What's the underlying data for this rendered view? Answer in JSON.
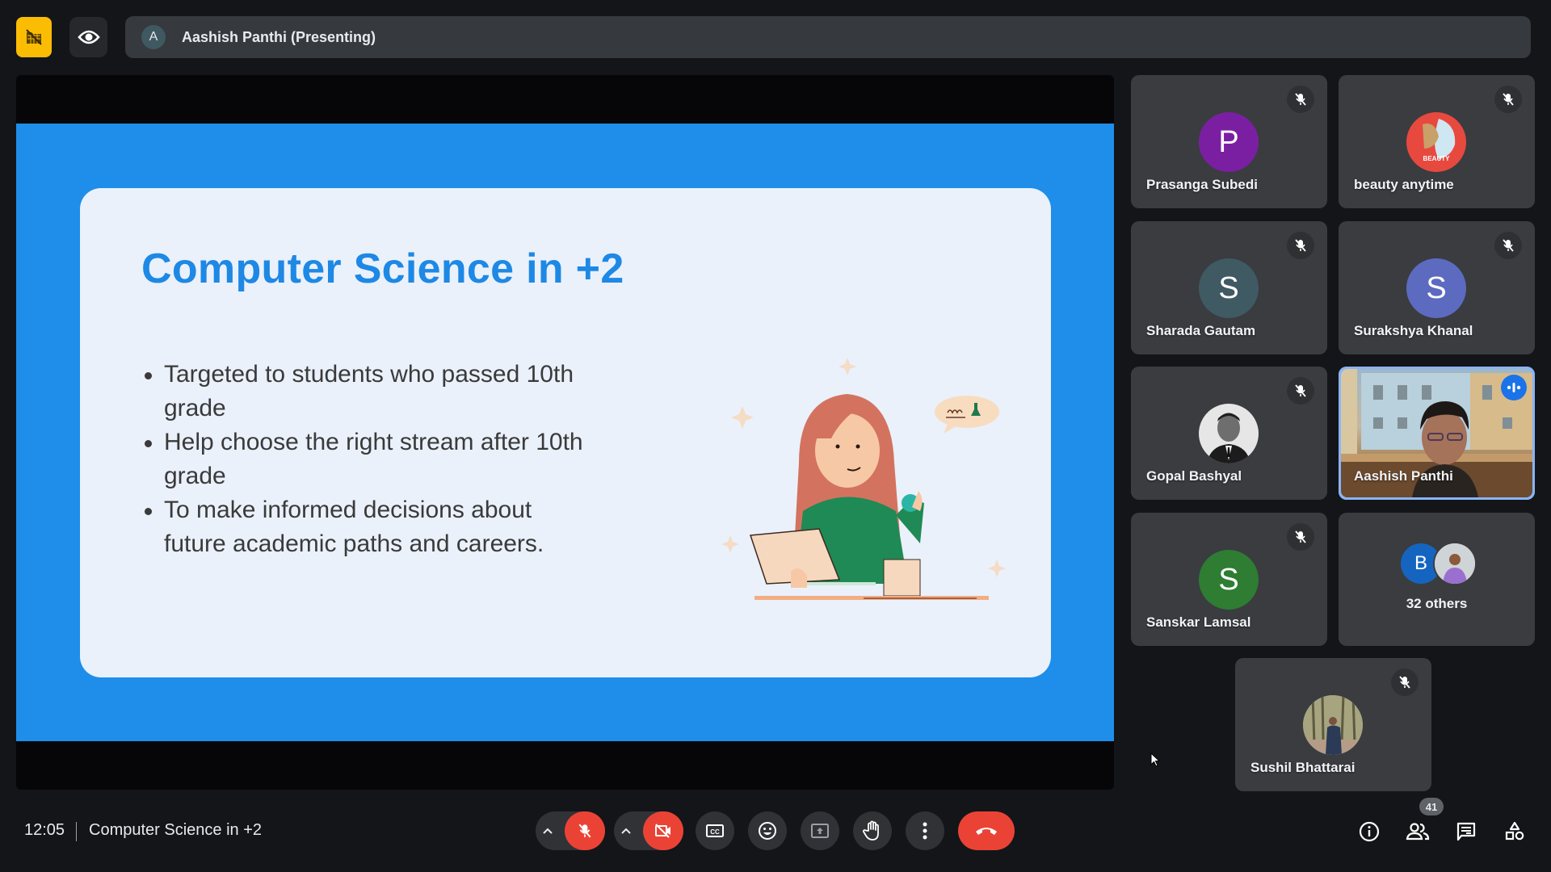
{
  "top_bar": {
    "recording_icon": "no-recording-icon",
    "view_icon": "eye-icon",
    "presenter_initial": "A",
    "presenter_label": "Aashish Panthi (Presenting)"
  },
  "slide": {
    "title": "Computer Science in +2",
    "bullets": [
      "Targeted to students who passed 10th grade",
      "Help choose the right stream after 10th grade",
      "To make informed decisions about future academic paths and careers."
    ],
    "colors": {
      "background": "#1e8eea",
      "card": "#eaf1fb",
      "title": "#1e88e5"
    }
  },
  "participants": [
    {
      "name": "Prasanga Subedi",
      "initial": "P",
      "avatar_color": "#7b1fa2",
      "muted": true
    },
    {
      "name": "beauty anytime",
      "initial": "",
      "avatar_color": "#e8493f",
      "muted": true,
      "avatar_type": "logo"
    },
    {
      "name": "Sharada Gautam",
      "initial": "S",
      "avatar_color": "#3f5a63",
      "muted": true
    },
    {
      "name": "Surakshya Khanal",
      "initial": "S",
      "avatar_color": "#5c6bc0",
      "muted": true
    },
    {
      "name": "Gopal Bashyal",
      "initial": "",
      "avatar_color": "#e0e0e0",
      "muted": true,
      "avatar_type": "photo"
    },
    {
      "name": "Aashish Panthi",
      "initial": "",
      "muted": false,
      "speaking": true,
      "avatar_type": "video"
    },
    {
      "name": "Sanskar Lamsal",
      "initial": "S",
      "avatar_color": "#2e7d32",
      "muted": true
    },
    {
      "name": "Sushil Bhattarai",
      "initial": "",
      "avatar_color": "#8d8a6a",
      "muted": true,
      "avatar_type": "photo"
    }
  ],
  "others_tile": {
    "label": "32 others",
    "initial": "B",
    "avatar_color": "#1565c0"
  },
  "bottom_bar": {
    "time": "12:05",
    "meeting_title": "Computer Science in +2",
    "controls": [
      {
        "name": "mic",
        "state": "off"
      },
      {
        "name": "camera",
        "state": "off"
      },
      {
        "name": "captions"
      },
      {
        "name": "reactions"
      },
      {
        "name": "present"
      },
      {
        "name": "raise-hand"
      },
      {
        "name": "more-options"
      },
      {
        "name": "leave-call"
      }
    ],
    "participant_count": "41",
    "colors": {
      "danger": "#ea4335",
      "accent": "#1a73e8"
    }
  }
}
